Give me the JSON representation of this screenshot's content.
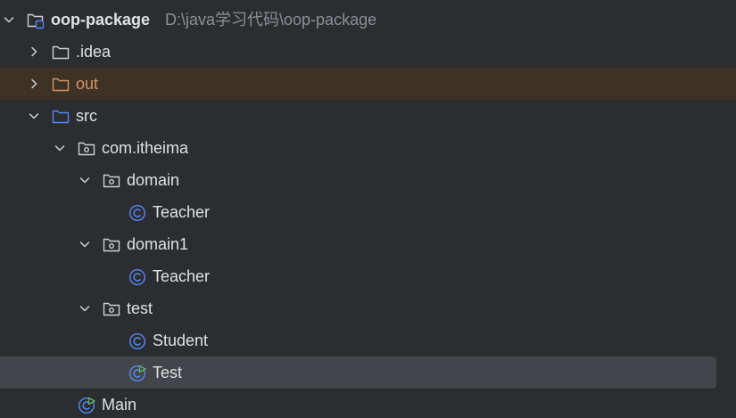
{
  "tree": {
    "root": {
      "name": "oop-package",
      "path": "D:\\java学习代码\\oop-package"
    },
    "idea": {
      "name": ".idea"
    },
    "out": {
      "name": "out"
    },
    "src": {
      "name": "src"
    },
    "pkg_com_itheima": {
      "name": "com.itheima"
    },
    "pkg_domain": {
      "name": "domain"
    },
    "class_teacher_1": {
      "name": "Teacher"
    },
    "pkg_domain1": {
      "name": "domain1"
    },
    "class_teacher_2": {
      "name": "Teacher"
    },
    "pkg_test": {
      "name": "test"
    },
    "class_student": {
      "name": "Student"
    },
    "class_test": {
      "name": "Test"
    },
    "class_main": {
      "name": "Main"
    }
  },
  "colors": {
    "background": "#2b2d30",
    "text": "#dfe1e5",
    "path_text": "#8c8f96",
    "excluded_text": "#d5946b",
    "excluded_row": "#3d3223",
    "selected_row": "#43454a",
    "folder_blue": "#548af7",
    "class_icon": "#548af7",
    "run_badge": "#5fb865"
  },
  "icons": {
    "root": "module-folder-icon",
    "idea": "folder-icon",
    "out": "excluded-folder-icon",
    "src": "source-root-folder-icon",
    "package": "package-icon",
    "class": "class-icon",
    "runnable_class": "runnable-class-icon",
    "expand": "chevron-down-icon",
    "collapse": "chevron-right-icon"
  }
}
